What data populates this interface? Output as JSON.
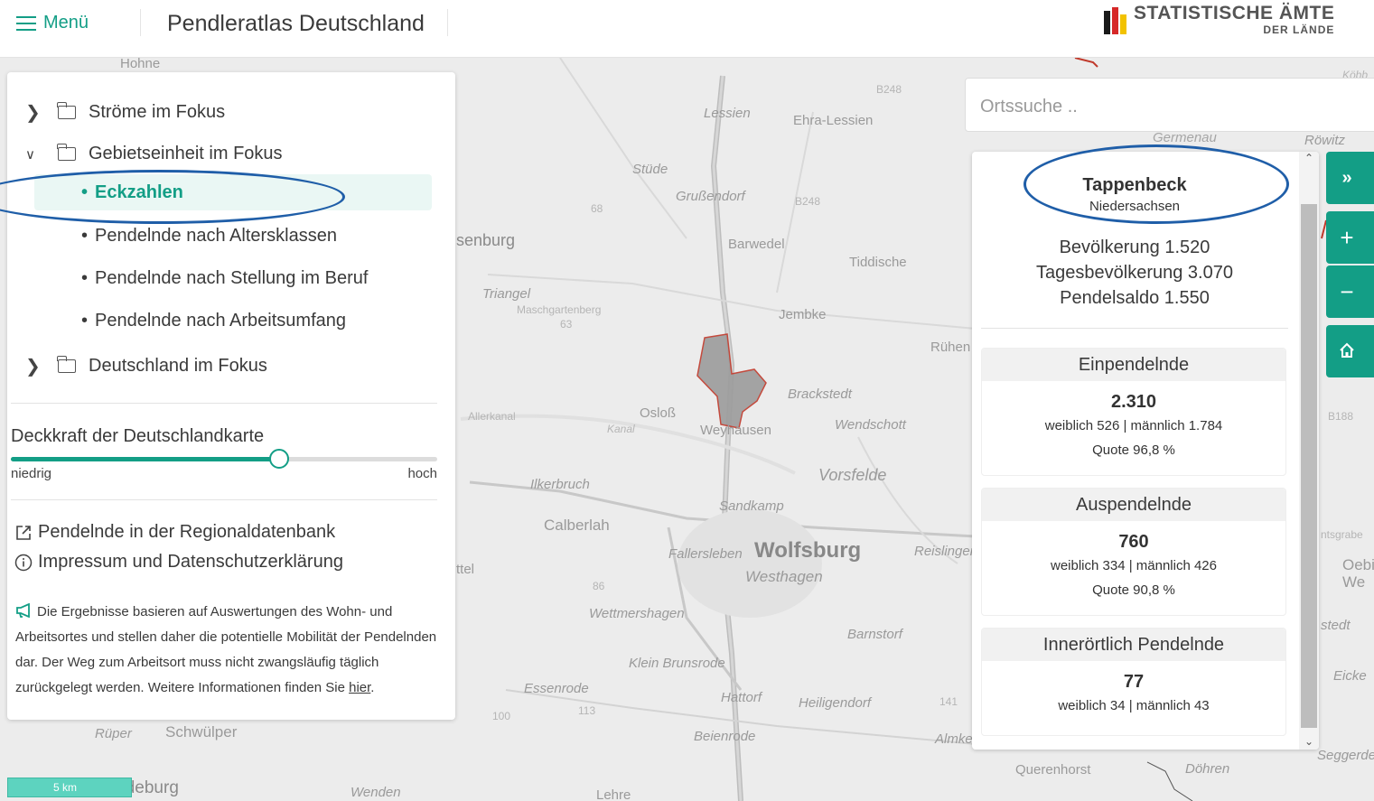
{
  "header": {
    "menu_label": "Menü",
    "title": "Pendleratlas Deutschland",
    "logo_line1": "STATISTISCHE ÄMTE",
    "logo_line2": "DER LÄNDE"
  },
  "sidebar": {
    "tree": [
      {
        "label": "Ströme im Fokus",
        "expanded": false
      },
      {
        "label": "Gebietseinheit im Fokus",
        "expanded": true
      },
      {
        "label": "Deutschland im Fokus",
        "expanded": false
      }
    ],
    "sub_items": [
      {
        "label": "Eckzahlen",
        "active": true
      },
      {
        "label": "Pendelnde nach Altersklassen",
        "active": false
      },
      {
        "label": "Pendelnde nach Stellung im Beruf",
        "active": false
      },
      {
        "label": "Pendelnde nach Arbeitsumfang",
        "active": false
      }
    ],
    "opacity": {
      "title": "Deckkraft der Deutschlandkarte",
      "min_label": "niedrig",
      "max_label": "hoch",
      "value": 0.63
    },
    "links": [
      {
        "label": "Pendelnde in der Regionaldatenbank",
        "icon": "external-link-icon"
      },
      {
        "label": "Impressum und Datenschutzerklärung",
        "icon": "info-circle-icon"
      }
    ],
    "info": {
      "text": "Die Ergebnisse basieren auf Auswertungen des Wohn- und Arbeitsortes und stellen daher die potentielle Mobilität der Pendelnden dar. Der Weg zum Arbeitsort muss nicht zwangsläufig täglich zurückgelegt werden. Weitere Informationen finden Sie ",
      "link": "hier",
      "end": "."
    }
  },
  "search": {
    "placeholder": "Ortssuche .."
  },
  "place": {
    "name": "Tappenbeck",
    "state": "Niedersachsen",
    "stats": [
      "Bevölkerung 1.520",
      "Tagesbevölkerung 3.070",
      "Pendelsaldo 1.550"
    ],
    "cards": [
      {
        "title": "Einpendelnde",
        "value": "2.310",
        "split": "weiblich 526 | männlich 1.784",
        "quote": "Quote 96,8 %"
      },
      {
        "title": "Auspendelnde",
        "value": "760",
        "split": "weiblich 334 | männlich 426",
        "quote": "Quote 90,8 %"
      },
      {
        "title": "Innerörtlich Pendelnde",
        "value": "77",
        "split": "weiblich 34 | männlich 43",
        "quote": ""
      }
    ]
  },
  "map": {
    "scale_label": "5 km",
    "labels": [
      "Hohne",
      "Lessien",
      "Ehra-Lessien",
      "B248",
      "Stüde",
      "Grußendorf",
      "B248",
      "68",
      "senburg",
      "Barwedel",
      "Tiddische",
      "Triangel",
      "Maschgartenberg",
      "63",
      "Jembke",
      "Rühen",
      "Brackstedt",
      "Allerkanal",
      "Osloß",
      "Kanal",
      "Weyhausen",
      "Wendschott",
      "Vorsfelde",
      "Ilkerbruch",
      "Sandkamp",
      "Calberlah",
      "Fallersleben",
      "Wolfsburg",
      "Westhagen",
      "Reislingen",
      "ttel",
      "86",
      "Wettmershagen",
      "Barnstorf",
      "Klein Brunsrode",
      "Essenrode",
      "113",
      "Hattorf",
      "Heiligendorf",
      "141",
      "100",
      "Rüper",
      "Schwülper",
      "Beienrode",
      "Almke",
      "Wendeburg",
      "Wenden",
      "Lehre",
      "Querenhorst",
      "Döhren",
      "Germenau",
      "Röwitz",
      "Köbb",
      "B188",
      "Oebisfelde-We",
      "Eicke",
      "stedt",
      "ntsgrabe",
      "Seggerde"
    ]
  },
  "colors": {
    "accent": "#139e86",
    "highlight": "#1f5ea8",
    "region_fill": "#9c9c9c",
    "region_border": "#c0392b"
  }
}
